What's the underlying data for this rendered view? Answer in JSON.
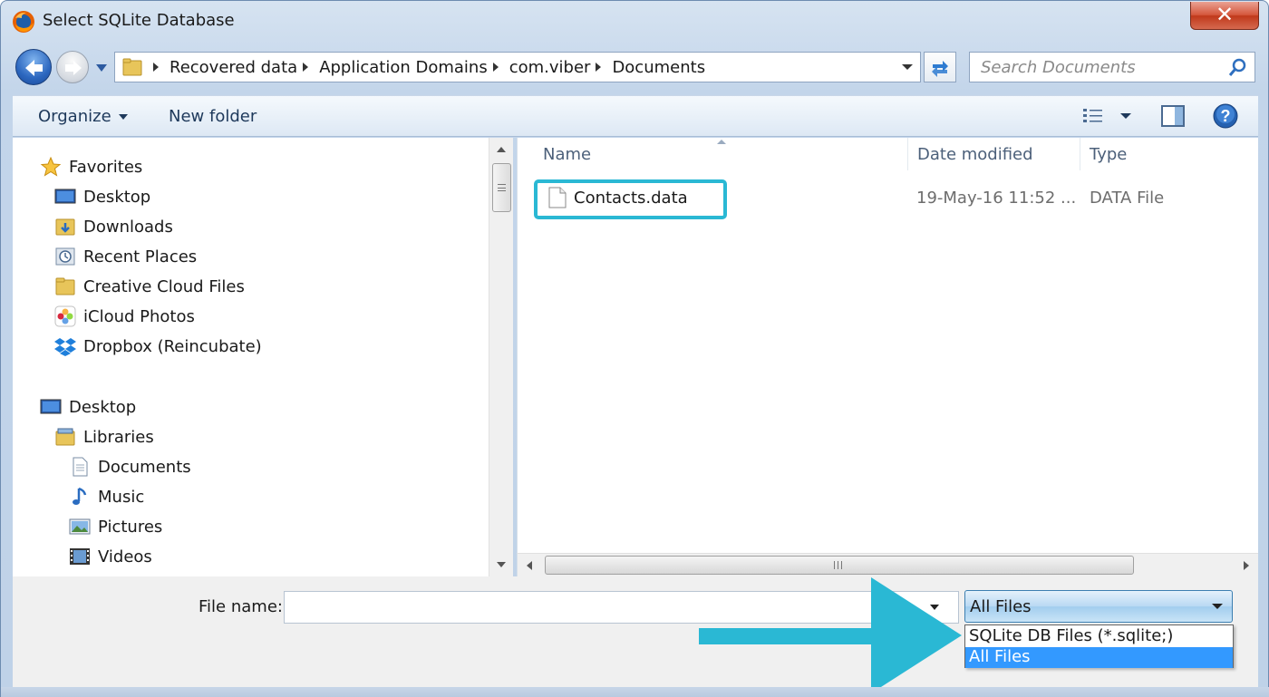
{
  "window": {
    "title": "Select SQLite Database",
    "close_label": "✕"
  },
  "address_bar": {
    "crumbs": [
      "Recovered data",
      "Application Domains",
      "com.viber",
      "Documents"
    ]
  },
  "search": {
    "placeholder": "Search Documents"
  },
  "toolbar": {
    "organize_label": "Organize",
    "new_folder_label": "New folder"
  },
  "nav_pane": {
    "favorites": {
      "label": "Favorites",
      "items": [
        "Desktop",
        "Downloads",
        "Recent Places",
        "Creative Cloud Files",
        "iCloud Photos",
        "Dropbox (Reincubate)"
      ]
    },
    "desktop": {
      "label": "Desktop",
      "libraries_label": "Libraries",
      "library_items": [
        "Documents",
        "Music",
        "Pictures",
        "Videos"
      ]
    }
  },
  "file_list": {
    "columns": {
      "name": "Name",
      "date": "Date modified",
      "type": "Type"
    },
    "files": [
      {
        "name": "Contacts.data",
        "date": "19-May-16 11:52 ...",
        "type": "DATA File"
      }
    ]
  },
  "bottom": {
    "file_name_label": "File name:",
    "file_name_value": "",
    "filter_selected": "All Files",
    "filter_options": [
      "SQLite DB Files (*.sqlite;)",
      "All Files"
    ]
  },
  "colors": {
    "highlight": "#2ab8d4",
    "selection": "#3399ff"
  }
}
